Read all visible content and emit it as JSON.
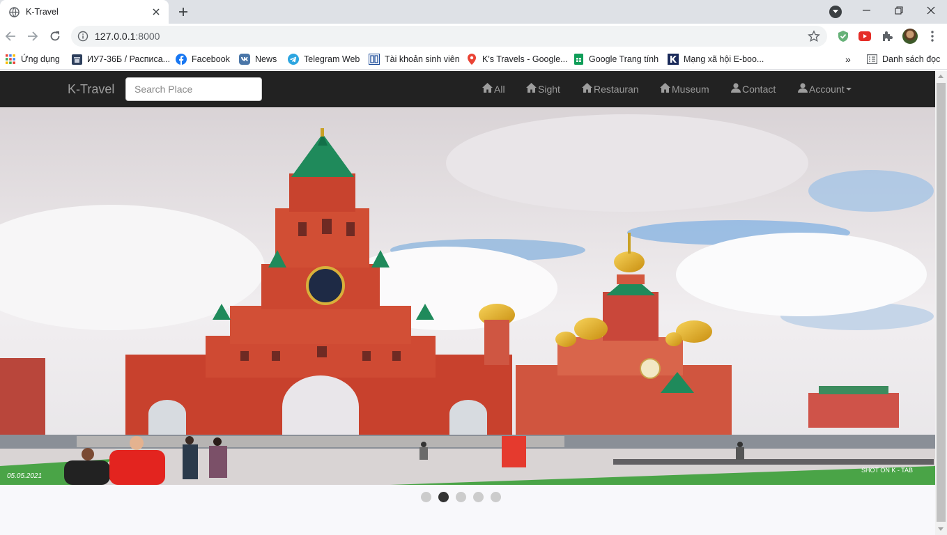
{
  "browser": {
    "tab": {
      "title": "K-Travel"
    },
    "address": {
      "host": "127.0.0.1",
      "port": ":8000"
    },
    "bookmarks": [
      {
        "label": "Ứng dụng",
        "icon": "apps-grid-icon"
      },
      {
        "label": "ИУ7-36Б / Расписа...",
        "icon": "bmstu-icon"
      },
      {
        "label": "Facebook",
        "icon": "facebook-icon"
      },
      {
        "label": "News",
        "icon": "vk-icon"
      },
      {
        "label": "Telegram Web",
        "icon": "telegram-icon"
      },
      {
        "label": "Tài khoản sinh viên",
        "icon": "university-icon"
      },
      {
        "label": "K's Travels - Google...",
        "icon": "google-maps-icon"
      },
      {
        "label": "Google Trang tính",
        "icon": "google-sheets-icon"
      },
      {
        "label": "Mạng xã hội E-boo...",
        "icon": "k-logo-icon"
      }
    ],
    "more_bookmarks": "»",
    "reading_list": "Danh sách đọc"
  },
  "page": {
    "navbar": {
      "brand": "K-Travel",
      "search_placeholder": "Search Place",
      "items": [
        {
          "label": "All",
          "icon": "home-icon"
        },
        {
          "label": "Sight",
          "icon": "home-icon"
        },
        {
          "label": "Restauran",
          "icon": "home-icon"
        },
        {
          "label": "Museum",
          "icon": "home-icon"
        },
        {
          "label": "Contact",
          "icon": "user-icon"
        },
        {
          "label": "Account",
          "icon": "user-icon"
        }
      ]
    },
    "carousel": {
      "slide_date": "05.05.2021",
      "watermark": "SHOT ON K - TAB",
      "slide_count": 5,
      "active_slide": 2
    }
  },
  "colors": {
    "navbar_bg": "#222222",
    "navbar_text": "#9d9d9d",
    "dot_active": "#333333",
    "dot_inactive": "#cccccc"
  }
}
